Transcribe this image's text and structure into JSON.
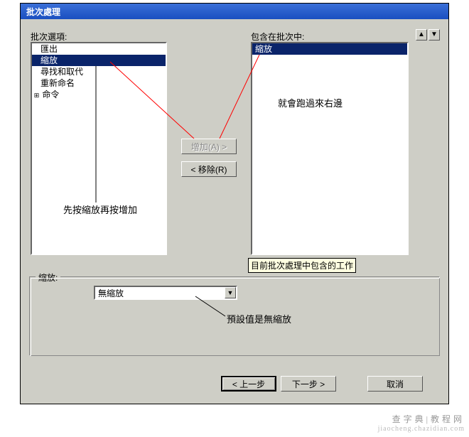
{
  "dialog": {
    "title": "批次處理"
  },
  "left": {
    "label": "批次選項:",
    "items": [
      "匯出",
      "縮放",
      "尋找和取代",
      "重新命名",
      "命令"
    ],
    "selected_index": 1,
    "expand_items": [
      4
    ]
  },
  "center": {
    "add_label": "增加(A) >",
    "remove_label": "< 移除(R)"
  },
  "right": {
    "label": "包含在批次中:",
    "items": [
      "縮放"
    ],
    "tooltip": "目前批次處理中包含的工作"
  },
  "ordering": {
    "up_glyph": "▲",
    "down_glyph": "▼"
  },
  "group": {
    "caption": "縮放:",
    "combo_value": "無縮放",
    "combo_glyph": "▼"
  },
  "footer": {
    "back_label": "< 上一步",
    "next_label": "下一步 >",
    "cancel_label": "取消"
  },
  "annotations": {
    "right_note": "就會跑過來右邊",
    "left_note": "先按縮放再按增加",
    "combo_note": "預設值是無縮放"
  },
  "watermark": {
    "line1": "查字典|教程网",
    "line2": "jiaocheng.chazidian.com"
  }
}
